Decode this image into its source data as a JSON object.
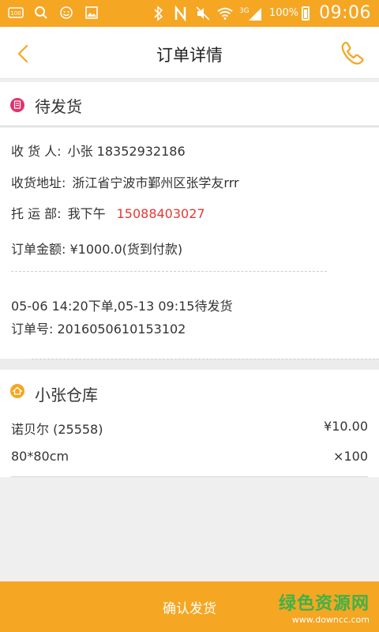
{
  "statusbar": {
    "battery_pct": "100%",
    "network": "3G",
    "time": "09:06",
    "left_icons": [
      "notification-100-icon",
      "search-icon",
      "face-icon",
      "gallery-icon"
    ],
    "right_icons": [
      "bluetooth-icon",
      "nfc-icon",
      "mute-icon",
      "wifi-icon",
      "signal-icon",
      "battery-icon"
    ]
  },
  "header": {
    "title": "订单详情"
  },
  "order_status": {
    "label": "待发货"
  },
  "order_info": {
    "receiver_label": "收 货 人:",
    "receiver_value": "小张 18352932186",
    "address_label": "收货地址:",
    "address_value": "浙江省宁波市鄞州区张学友rrr",
    "carrier_label": "托 运 部:",
    "carrier_value": "我下午",
    "carrier_phone": "15088403027",
    "amount_text": "订单金额: ¥1000.0(货到付款)",
    "timeline": "05-06 14:20下单,05-13 09:15待发货",
    "order_no": "订单号: 2016050610153102"
  },
  "warehouse": {
    "name": "小张仓库",
    "item_name": "诺贝尔  (25558)",
    "item_price": "¥10.00",
    "item_spec": "80*80cm",
    "item_qty": "×100"
  },
  "footer": {
    "confirm_label": "确认发货",
    "watermark_title": "绿色资源网",
    "watermark_url": "www.downcc.com"
  },
  "colors": {
    "accent": "#f5a623",
    "status_icon": "#e0336b",
    "phone_red": "#e53935",
    "watermark_green": "#3cb34a"
  }
}
